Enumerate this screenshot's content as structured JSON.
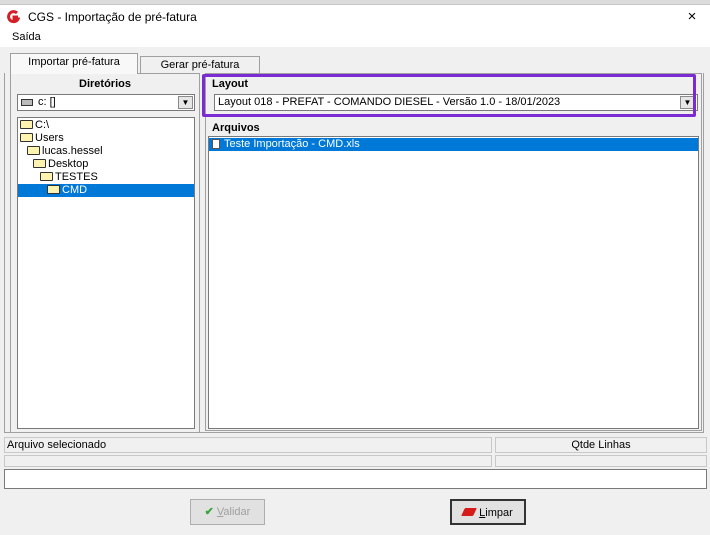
{
  "window": {
    "title": "CGS - Importação de pré-fatura",
    "close_glyph": "×"
  },
  "menu": {
    "items": [
      {
        "label": "Saída"
      }
    ]
  },
  "tabs": [
    {
      "label": "Importar pré-fatura",
      "active": true
    },
    {
      "label": "Gerar pré-fatura",
      "active": false
    }
  ],
  "directories": {
    "header": "Diretórios",
    "drive": "c: []",
    "tree": [
      {
        "label": "C:\\",
        "selected": false
      },
      {
        "label": "Users",
        "selected": false
      },
      {
        "label": "lucas.hessel",
        "selected": false
      },
      {
        "label": "Desktop",
        "selected": false
      },
      {
        "label": "TESTES",
        "selected": false
      },
      {
        "label": "CMD",
        "selected": true
      }
    ]
  },
  "layout": {
    "label": "Layout",
    "selected": "Layout 018 - PREFAT - COMANDO DIESEL - Versão 1.0 - 18/01/2023"
  },
  "files": {
    "label": "Arquivos",
    "items": [
      {
        "name": "Teste Importação - CMD.xls",
        "selected": true
      }
    ]
  },
  "status": {
    "selected_file_label": "Arquivo selecionado",
    "qtde_label": "Qtde Linhas"
  },
  "buttons": {
    "validar_first": "V",
    "validar_rest": "alidar",
    "limpar_first": "L",
    "limpar_rest": "impar"
  },
  "colors": {
    "selection": "#0078d7",
    "highlight": "#7a2bd1",
    "app_icon": "#d41f26"
  },
  "icons": [
    "app-logo-icon",
    "close-icon",
    "drive-icon",
    "dropdown-arrow-icon",
    "folder-icon",
    "file-icon",
    "check-icon",
    "eraser-icon"
  ]
}
